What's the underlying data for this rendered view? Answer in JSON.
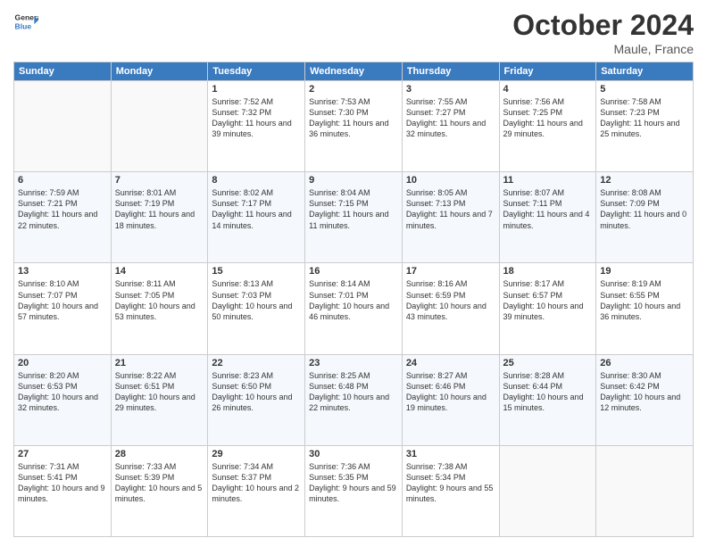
{
  "header": {
    "logo_line1": "General",
    "logo_line2": "Blue",
    "month": "October 2024",
    "location": "Maule, France"
  },
  "weekdays": [
    "Sunday",
    "Monday",
    "Tuesday",
    "Wednesday",
    "Thursday",
    "Friday",
    "Saturday"
  ],
  "weeks": [
    [
      {
        "day": "",
        "info": ""
      },
      {
        "day": "",
        "info": ""
      },
      {
        "day": "1",
        "info": "Sunrise: 7:52 AM\nSunset: 7:32 PM\nDaylight: 11 hours and 39 minutes."
      },
      {
        "day": "2",
        "info": "Sunrise: 7:53 AM\nSunset: 7:30 PM\nDaylight: 11 hours and 36 minutes."
      },
      {
        "day": "3",
        "info": "Sunrise: 7:55 AM\nSunset: 7:27 PM\nDaylight: 11 hours and 32 minutes."
      },
      {
        "day": "4",
        "info": "Sunrise: 7:56 AM\nSunset: 7:25 PM\nDaylight: 11 hours and 29 minutes."
      },
      {
        "day": "5",
        "info": "Sunrise: 7:58 AM\nSunset: 7:23 PM\nDaylight: 11 hours and 25 minutes."
      }
    ],
    [
      {
        "day": "6",
        "info": "Sunrise: 7:59 AM\nSunset: 7:21 PM\nDaylight: 11 hours and 22 minutes."
      },
      {
        "day": "7",
        "info": "Sunrise: 8:01 AM\nSunset: 7:19 PM\nDaylight: 11 hours and 18 minutes."
      },
      {
        "day": "8",
        "info": "Sunrise: 8:02 AM\nSunset: 7:17 PM\nDaylight: 11 hours and 14 minutes."
      },
      {
        "day": "9",
        "info": "Sunrise: 8:04 AM\nSunset: 7:15 PM\nDaylight: 11 hours and 11 minutes."
      },
      {
        "day": "10",
        "info": "Sunrise: 8:05 AM\nSunset: 7:13 PM\nDaylight: 11 hours and 7 minutes."
      },
      {
        "day": "11",
        "info": "Sunrise: 8:07 AM\nSunset: 7:11 PM\nDaylight: 11 hours and 4 minutes."
      },
      {
        "day": "12",
        "info": "Sunrise: 8:08 AM\nSunset: 7:09 PM\nDaylight: 11 hours and 0 minutes."
      }
    ],
    [
      {
        "day": "13",
        "info": "Sunrise: 8:10 AM\nSunset: 7:07 PM\nDaylight: 10 hours and 57 minutes."
      },
      {
        "day": "14",
        "info": "Sunrise: 8:11 AM\nSunset: 7:05 PM\nDaylight: 10 hours and 53 minutes."
      },
      {
        "day": "15",
        "info": "Sunrise: 8:13 AM\nSunset: 7:03 PM\nDaylight: 10 hours and 50 minutes."
      },
      {
        "day": "16",
        "info": "Sunrise: 8:14 AM\nSunset: 7:01 PM\nDaylight: 10 hours and 46 minutes."
      },
      {
        "day": "17",
        "info": "Sunrise: 8:16 AM\nSunset: 6:59 PM\nDaylight: 10 hours and 43 minutes."
      },
      {
        "day": "18",
        "info": "Sunrise: 8:17 AM\nSunset: 6:57 PM\nDaylight: 10 hours and 39 minutes."
      },
      {
        "day": "19",
        "info": "Sunrise: 8:19 AM\nSunset: 6:55 PM\nDaylight: 10 hours and 36 minutes."
      }
    ],
    [
      {
        "day": "20",
        "info": "Sunrise: 8:20 AM\nSunset: 6:53 PM\nDaylight: 10 hours and 32 minutes."
      },
      {
        "day": "21",
        "info": "Sunrise: 8:22 AM\nSunset: 6:51 PM\nDaylight: 10 hours and 29 minutes."
      },
      {
        "day": "22",
        "info": "Sunrise: 8:23 AM\nSunset: 6:50 PM\nDaylight: 10 hours and 26 minutes."
      },
      {
        "day": "23",
        "info": "Sunrise: 8:25 AM\nSunset: 6:48 PM\nDaylight: 10 hours and 22 minutes."
      },
      {
        "day": "24",
        "info": "Sunrise: 8:27 AM\nSunset: 6:46 PM\nDaylight: 10 hours and 19 minutes."
      },
      {
        "day": "25",
        "info": "Sunrise: 8:28 AM\nSunset: 6:44 PM\nDaylight: 10 hours and 15 minutes."
      },
      {
        "day": "26",
        "info": "Sunrise: 8:30 AM\nSunset: 6:42 PM\nDaylight: 10 hours and 12 minutes."
      }
    ],
    [
      {
        "day": "27",
        "info": "Sunrise: 7:31 AM\nSunset: 5:41 PM\nDaylight: 10 hours and 9 minutes."
      },
      {
        "day": "28",
        "info": "Sunrise: 7:33 AM\nSunset: 5:39 PM\nDaylight: 10 hours and 5 minutes."
      },
      {
        "day": "29",
        "info": "Sunrise: 7:34 AM\nSunset: 5:37 PM\nDaylight: 10 hours and 2 minutes."
      },
      {
        "day": "30",
        "info": "Sunrise: 7:36 AM\nSunset: 5:35 PM\nDaylight: 9 hours and 59 minutes."
      },
      {
        "day": "31",
        "info": "Sunrise: 7:38 AM\nSunset: 5:34 PM\nDaylight: 9 hours and 55 minutes."
      },
      {
        "day": "",
        "info": ""
      },
      {
        "day": "",
        "info": ""
      }
    ]
  ]
}
